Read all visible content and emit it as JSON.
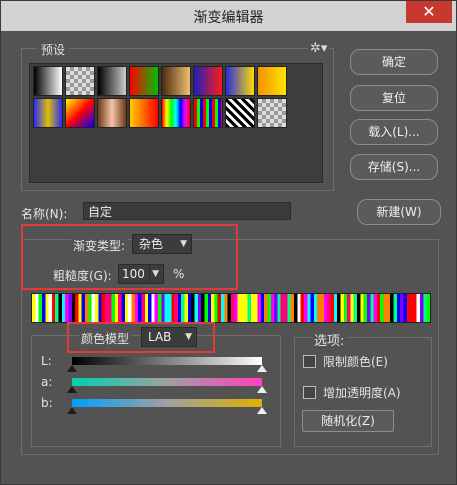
{
  "window": {
    "title": "渐变编辑器",
    "close": "✕"
  },
  "presets": {
    "legend": "预设",
    "gear": "✲▾",
    "swatches": [
      "linear-gradient(90deg,#000,#fff)",
      "repeating-conic-gradient(#999 0 25%,#ddd 0 50%) 0 0/8px 8px",
      "linear-gradient(90deg,#000,#ccc)",
      "linear-gradient(90deg,#ff0000,#00c000)",
      "linear-gradient(90deg,#4c2a10,#f0c070)",
      "linear-gradient(90deg,#1d1fbf,#ff1a1a)",
      "linear-gradient(90deg,#2b2be0,#ffdd00)",
      "linear-gradient(90deg,#f29100,#ffe400)",
      "linear-gradient(90deg,#2a2aff,#e0c000,#2a2aff)",
      "linear-gradient(135deg,#ff0,#f00 50%,#00f)",
      "linear-gradient(90deg,#6a3a1a,#f4c4a4,#6a3a1a)",
      "linear-gradient(90deg,#ffcc00,#ff0000)",
      "linear-gradient(90deg,#f00,#ff0,#0f0,#0ff,#00f,#f0f,#f00)",
      "repeating-linear-gradient(90deg,#ff0000 0 3px,#00ff00 3px 6px,#0000ff 6px 9px)",
      "repeating-linear-gradient(45deg,#000 0 3px,#fff 3px 6px)",
      "repeating-conic-gradient(#999 0 25%,#ddd 0 50%) 0 0/8px 8px"
    ]
  },
  "buttons": {
    "ok": "确定",
    "reset": "复位",
    "load": "载入(L)...",
    "save": "存储(S)...",
    "new": "新建(W)"
  },
  "name": {
    "label": "名称(N):",
    "value": "自定"
  },
  "gradient_type": {
    "label": "渐变类型:",
    "value": "杂色"
  },
  "roughness": {
    "label": "粗糙度(G):",
    "value": "100",
    "unit": "%"
  },
  "color_model": {
    "label": "颜色模型",
    "value": "LAB"
  },
  "channels": [
    {
      "label": "L:",
      "gradient": "linear-gradient(90deg,#000,#fff)",
      "left_pos": 0.0,
      "right_pos": 1.0
    },
    {
      "label": "a:",
      "gradient": "linear-gradient(90deg,#00d0b0,#a0a0a0 50%,#ff40c0)",
      "left_pos": 0.0,
      "right_pos": 1.0
    },
    {
      "label": "b:",
      "gradient": "linear-gradient(90deg,#00a0ff,#a0a0a0 50%,#e0b000)",
      "left_pos": 0.0,
      "right_pos": 1.0
    }
  ],
  "options": {
    "legend": "选项:",
    "restrict_colors": "限制颜色(E)",
    "add_transparency": "增加透明度(A)",
    "randomize": "随机化(Z)"
  },
  "colors": {
    "highlight": "#e03a3a",
    "bg": "#535353"
  }
}
